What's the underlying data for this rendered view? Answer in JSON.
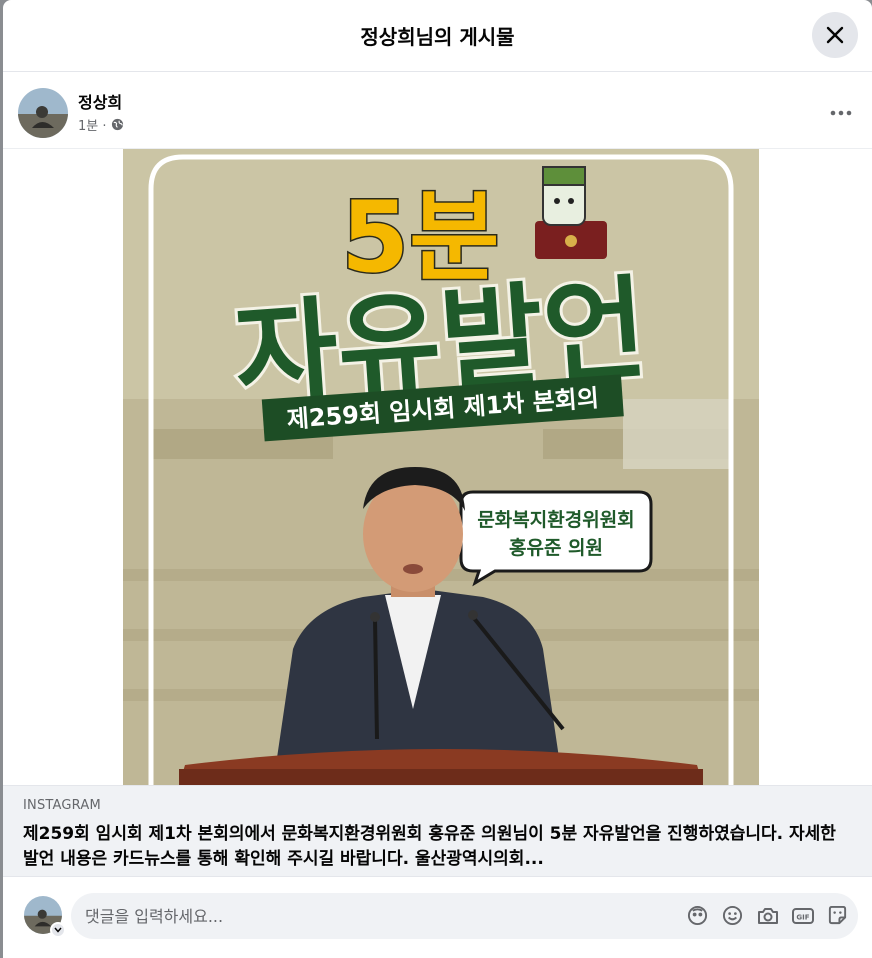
{
  "dialog": {
    "title": "정상희님의 게시물"
  },
  "post": {
    "author": "정상희",
    "time": "1분 ·",
    "privacy_icon": "globe-icon"
  },
  "media": {
    "headline_number": "5분",
    "headline_main": "자유발언",
    "session": "제259회 임시회 제1차 본회의",
    "speaker_committee": "문화복지환경위원회",
    "speaker_name": "홍유준 의원"
  },
  "link_preview": {
    "source": "INSTAGRAM",
    "caption": "제259회 임시회 제1차 본회의에서 문화복지환경위원회 홍유준 의원님이 5분 자유발언을 진행하였습니다. 자세한 발언 내용은 카드뉴스를 통해 확인해 주시길 바랍니다. 울산광역시의회..."
  },
  "comment": {
    "placeholder": "댓글을 입력하세요...",
    "icons": [
      "avatar-icon",
      "emoji-icon",
      "camera-icon",
      "gif-icon",
      "sticker-icon"
    ]
  },
  "colors": {
    "accent_yellow": "#f5b800",
    "headline_green": "#1f5a2a",
    "banner_green": "#1d4d25",
    "background_beige": "#cbc5a5"
  }
}
